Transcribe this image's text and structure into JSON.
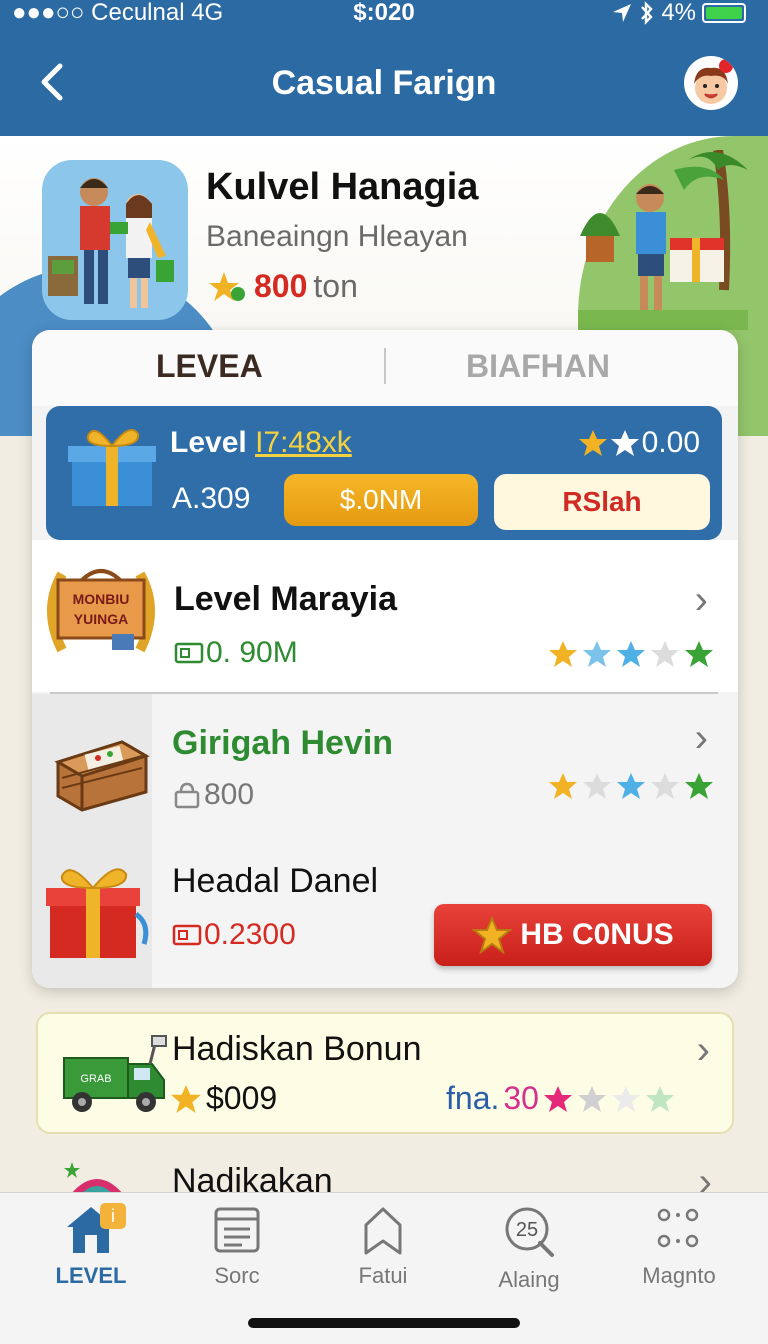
{
  "status_bar": {
    "carrier": "●●●○○ Ceculnal  4G",
    "time": "$:020",
    "battery_pct": "4%"
  },
  "nav": {
    "title": "Casual Farign"
  },
  "hero": {
    "title": "Kulvel Hanagia",
    "subtitle": "Baneaingn Hleayan",
    "points": "800",
    "points_unit": "ton"
  },
  "tabs": [
    {
      "label": "LEVEA",
      "active": true
    },
    {
      "label": "BIAFHAN",
      "active": false
    }
  ],
  "featured": {
    "level_label": "Level",
    "level_code": "I7:48xk",
    "score": "0.00",
    "balance": "A.309",
    "gold_button": "$.0NM",
    "cream_button": "RSlah"
  },
  "items": [
    {
      "title": "Level Marayia",
      "value": "0. 90M",
      "icon_text": "MONBIU YUINGA",
      "stars": [
        "#f1b324",
        "#7cc3ec",
        "#4fb0e6",
        "#dcdcdc",
        "#3aa335"
      ]
    },
    {
      "title": "Girigah Hevin",
      "value": "800",
      "stars": [
        "#f1b324",
        "#dcdcdc",
        "#4fb0e6",
        "#dcdcdc",
        "#3aa335"
      ]
    },
    {
      "title": "Headal Danel",
      "value": "0.2300",
      "button": "HB C0NUS"
    }
  ],
  "bonus": {
    "title": "Hadiskan Bonun",
    "amount": "$009",
    "fna_label": "fna.",
    "fna_value": "30",
    "truck_text": "GRAB"
  },
  "peek": {
    "title": "Nadikakan"
  },
  "bottom_nav": [
    {
      "label": "LEVEL",
      "active": true,
      "icon": "home-icon",
      "badge": "i"
    },
    {
      "label": "Sorc",
      "active": false,
      "icon": "list-icon"
    },
    {
      "label": "Fatui",
      "active": false,
      "icon": "bookmark-icon"
    },
    {
      "label": "Alaing",
      "active": false,
      "icon": "timer-icon",
      "icon_text": "25"
    },
    {
      "label": "Magnto",
      "active": false,
      "icon": "grid-dots-icon"
    }
  ],
  "colors": {
    "brand_blue": "#2c6aa3",
    "accent_red": "#d42a22",
    "accent_green": "#2e8b32",
    "gold": "#f1b324"
  }
}
